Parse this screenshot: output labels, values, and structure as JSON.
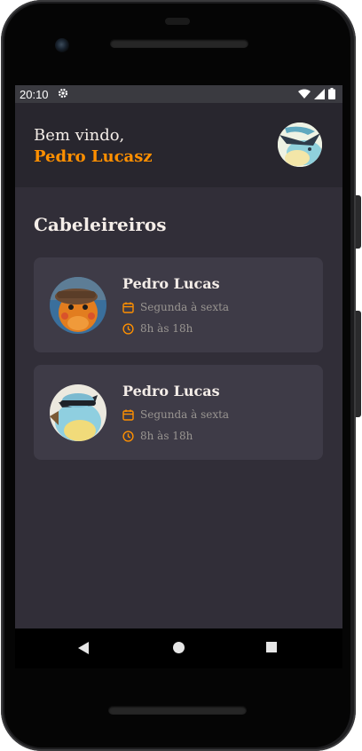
{
  "status_bar": {
    "time": "20:10",
    "icons": [
      "settings-icon",
      "wifi-icon",
      "signal-icon",
      "battery-icon"
    ]
  },
  "header": {
    "greeting": "Bem vindo,",
    "user_name": "Pedro Lucasz"
  },
  "section": {
    "title": "Cabeleireiros"
  },
  "providers": [
    {
      "name": "Pedro Lucas",
      "availability_days": "Segunda à sexta",
      "availability_hours": "8h às 18h"
    },
    {
      "name": "Pedro Lucas",
      "availability_days": "Segunda à sexta",
      "availability_hours": "8h às 18h"
    }
  ],
  "colors": {
    "accent": "#ff9000",
    "background": "#312e38",
    "header_bg": "#28262e",
    "card_bg": "#3e3b47",
    "text_primary": "#f4ede8",
    "text_secondary": "#999591"
  },
  "nav_bar": {
    "buttons": [
      "back-icon",
      "home-icon",
      "recent-apps-icon"
    ]
  }
}
